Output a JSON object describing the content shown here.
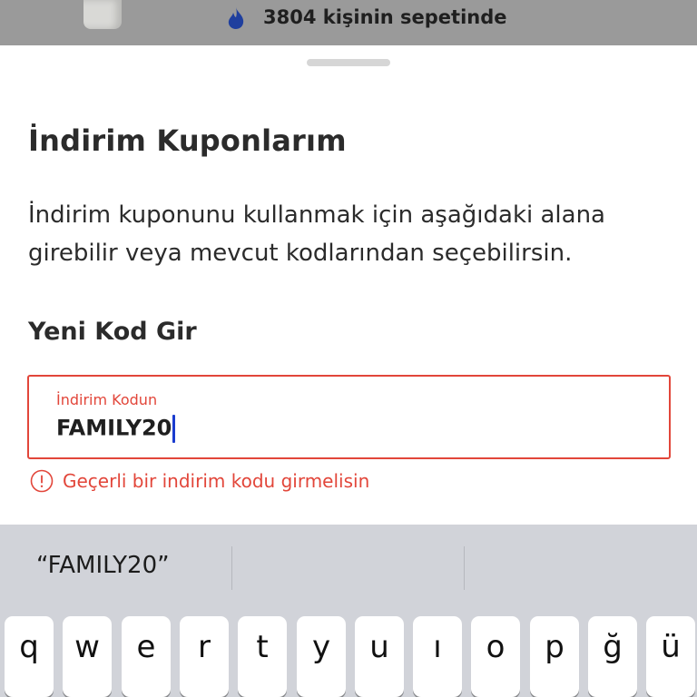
{
  "top_bar": {
    "cart_count_text": "3804 kişinin sepetinde"
  },
  "sheet": {
    "title": "İndirim Kuponlarım",
    "description": "İndirim kuponunu kullanmak için aşağıdaki alana girebilir veya mevcut kodlarından seçebilirsin.",
    "section_title": "Yeni Kod Gir",
    "code_field": {
      "label": "İndirim Kodun",
      "value": "FAMILY20"
    },
    "error": {
      "text": "Geçerli bir indirim kodu girmelisin"
    }
  },
  "keyboard": {
    "suggestions": [
      "“FAMILY20”",
      "",
      ""
    ],
    "keys_row1": [
      "q",
      "w",
      "e",
      "r",
      "t",
      "y",
      "u",
      "ı",
      "o",
      "p",
      "ğ",
      "ü"
    ]
  },
  "colors": {
    "error": "#e2463a",
    "caret": "#1a3ccf",
    "flame": "#1f3f9e"
  },
  "icons": {
    "flame": "flame-icon",
    "error": "alert-circle-icon"
  }
}
